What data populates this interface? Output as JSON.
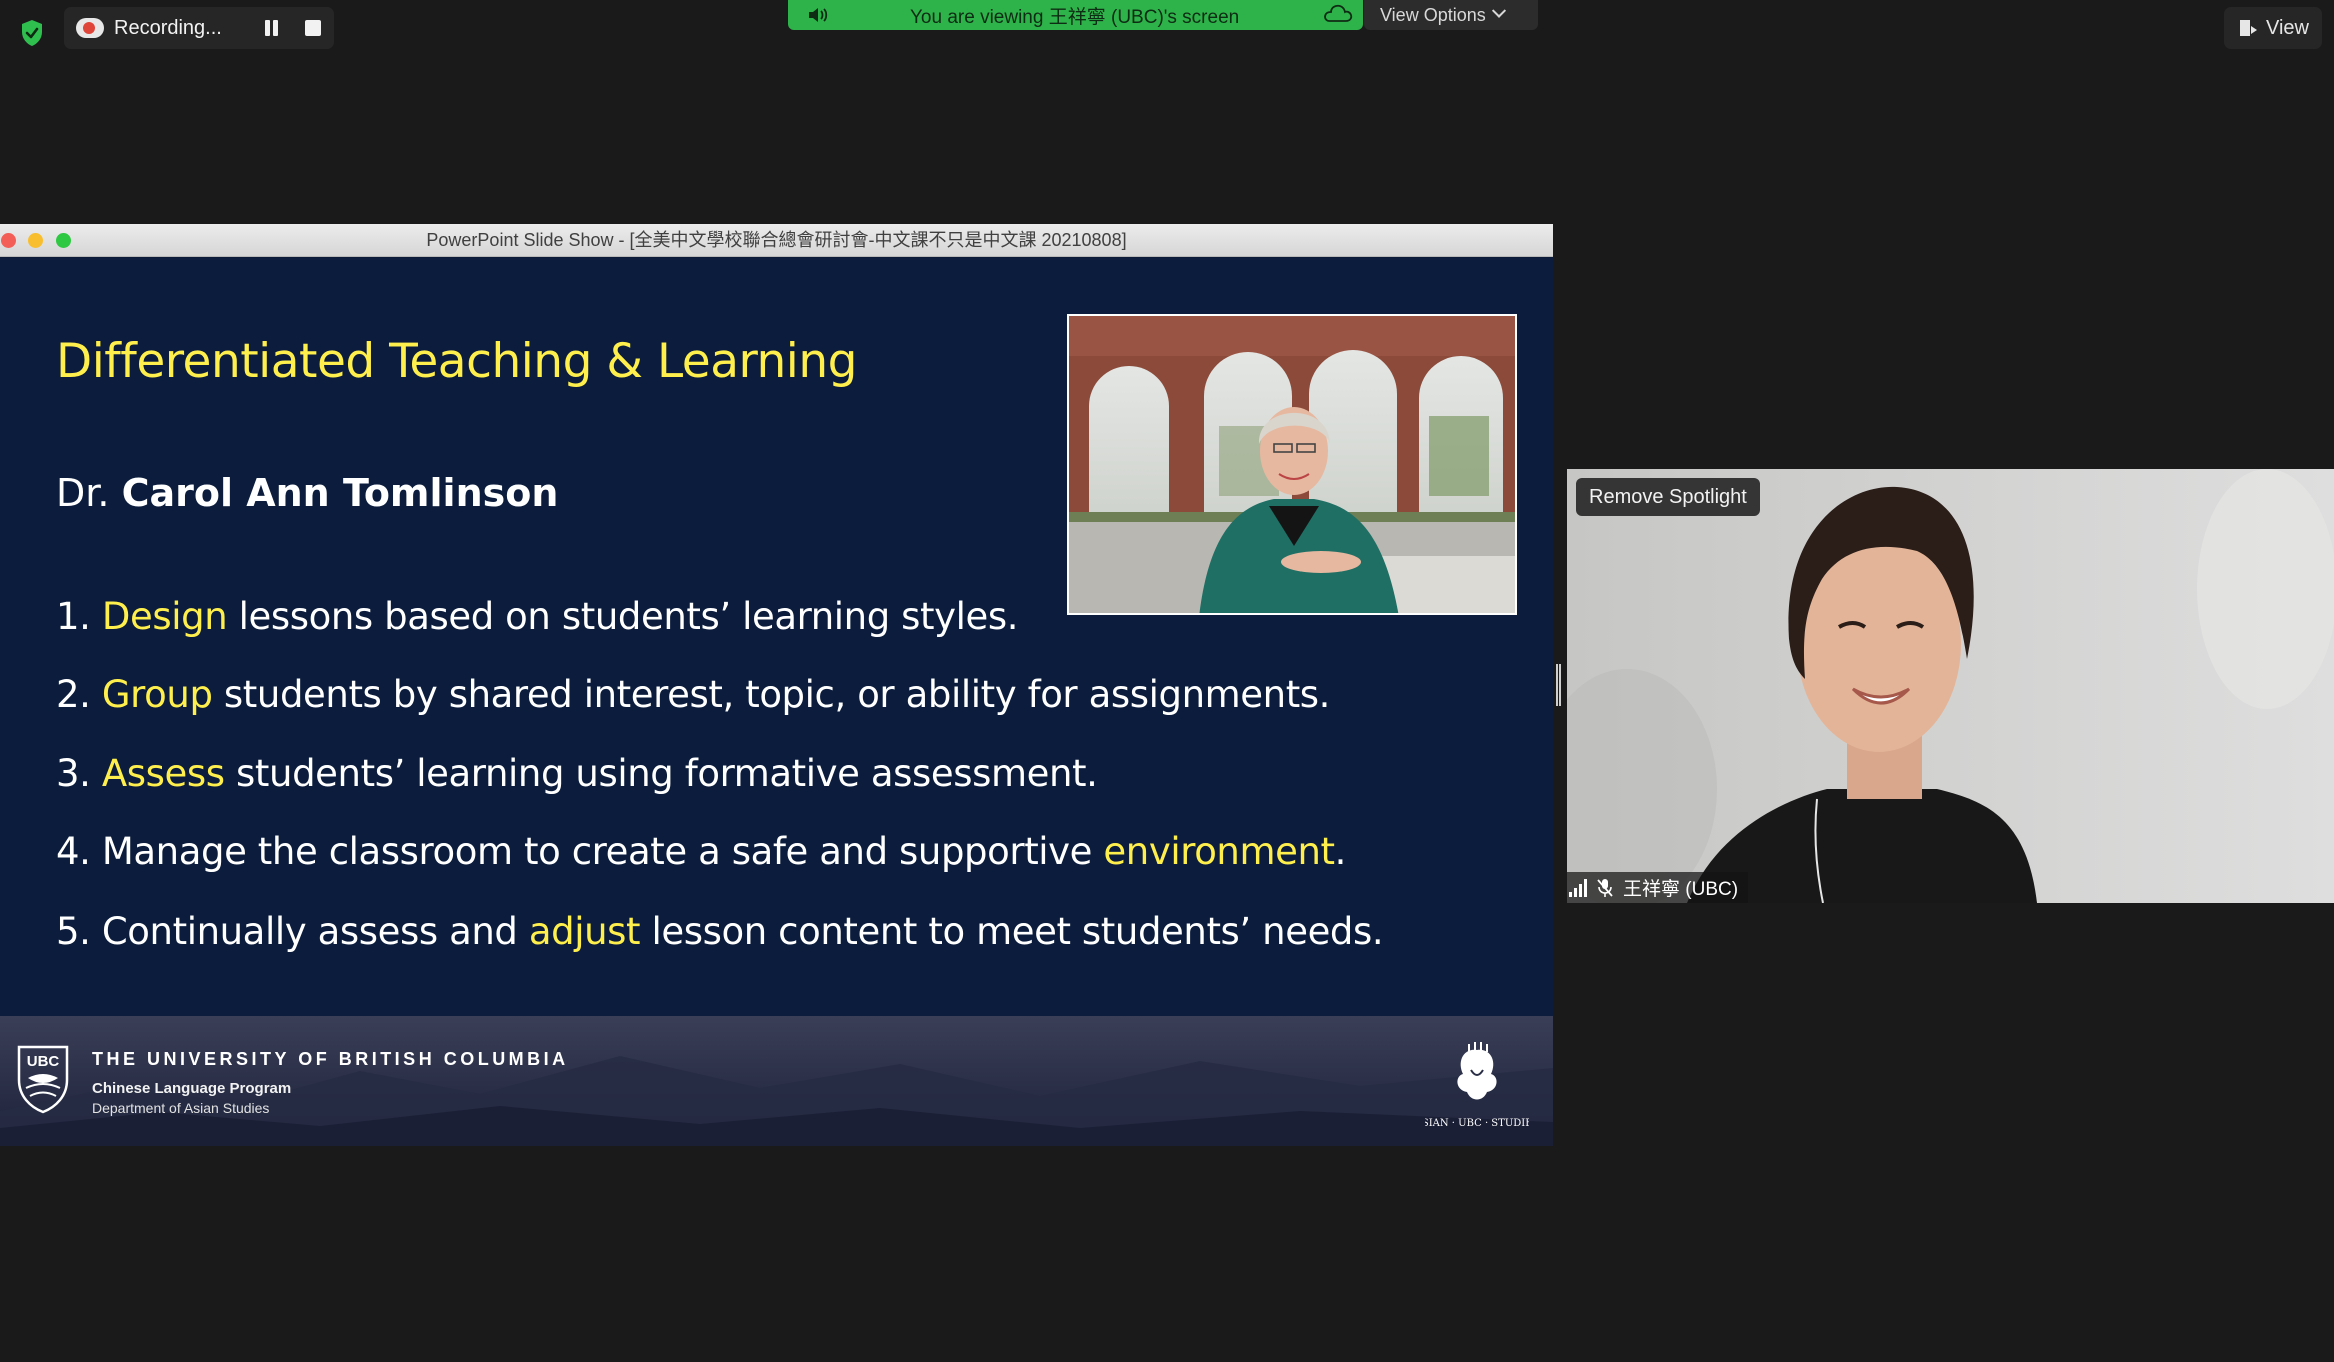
{
  "toolbar": {
    "recording_label": "Recording...",
    "banner_text": "You are viewing 王祥寧 (UBC)'s screen",
    "view_options_label": "View Options",
    "view_label": "View"
  },
  "share_window": {
    "title": "PowerPoint Slide Show - [全美中文學校聯合總會研討會-中文課不只是中文課 20210808]"
  },
  "slide": {
    "title": "Differentiated Teaching & Learning",
    "author_prefix": "Dr.",
    "author_name": "Carol Ann Tomlinson",
    "points": [
      {
        "num": "1.",
        "pre": "",
        "highlight": "Design",
        "post": " lessons based on students’ learning styles."
      },
      {
        "num": "2.",
        "pre": "",
        "highlight": "Group",
        "post": " students by shared interest, topic, or ability for assignments."
      },
      {
        "num": "3.",
        "pre": "",
        "highlight": "Assess",
        "post": " students’ learning using formative assessment."
      },
      {
        "num": "4.",
        "pre": " Manage the classroom to create a safe and supportive ",
        "highlight": "environment",
        "post": "."
      },
      {
        "num": "5.",
        "pre": " Continually assess and ",
        "highlight": "adjust",
        "post": " lesson content to meet students’ needs."
      }
    ],
    "footer": {
      "crest_text": "UBC",
      "university": "THE UNIVERSITY OF BRITISH COLUMBIA",
      "program": "Chinese Language Program",
      "department": "Department of Asian Studies",
      "logo_text": "ASIAN · UBC · STUDIES"
    }
  },
  "video": {
    "remove_spotlight_label": "Remove Spotlight",
    "participant_name": "王祥寧 (UBC)"
  },
  "colors": {
    "slide_bg": "#0b1c3c",
    "slide_highlight": "#ffef4d",
    "banner_green": "#2eb34a",
    "recording_red": "#e0453a"
  }
}
